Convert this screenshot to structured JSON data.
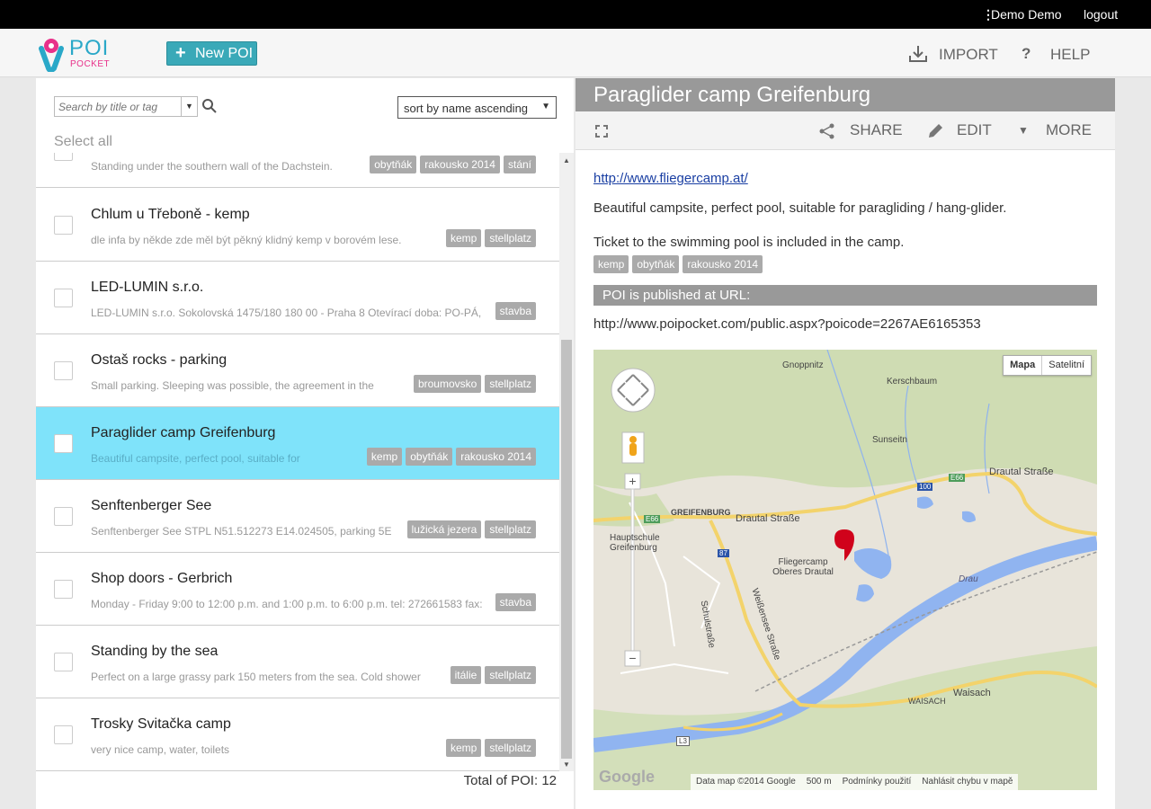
{
  "topbar": {
    "user": "Demo Demo",
    "logout": "logout"
  },
  "header": {
    "logo_poi": "POI",
    "logo_pocket": "POCKET",
    "new_poi": "New POI",
    "import": "IMPORT",
    "help": "HELP"
  },
  "list_controls": {
    "search_placeholder": "Search by title or tag",
    "sort_value": "sort by name ascending",
    "select_all": "Select all",
    "total": "Total of POI: 12"
  },
  "rows": [
    {
      "title": "",
      "desc": "Standing under the southern wall of the Dachstein.",
      "tags": [
        "obytňák",
        "rakousko 2014",
        "stání"
      ]
    },
    {
      "title": "Chlum u Třeboně - kemp",
      "desc": "dle infa by někde zde měl být pěkný klidný kemp v borovém lese.",
      "tags": [
        "kemp",
        "stellplatz"
      ]
    },
    {
      "title": "LED-LUMIN s.r.o.",
      "desc": "LED-LUMIN s.r.o. Sokolovská 1475/180 180 00 - Praha 8 Otevírací doba: PO-PÁ,",
      "tags": [
        "stavba"
      ]
    },
    {
      "title": "Ostaš rocks - parking",
      "desc": "Small parking.  Sleeping was possible, the agreement in the",
      "tags": [
        "broumovsko",
        "stellplatz"
      ]
    },
    {
      "title": "Paraglider camp Greifenburg",
      "desc": "Beautiful campsite, perfect pool, suitable for",
      "tags": [
        "kemp",
        "obytňák",
        "rakousko 2014"
      ]
    },
    {
      "title": "Senftenberger See",
      "desc": "Senftenberger See STPL N51.512273 E14.024505, parking 5E",
      "tags": [
        "lužická jezera",
        "stellplatz"
      ]
    },
    {
      "title": "Shop doors - Gerbrich",
      "desc": "Monday - Friday  9:00 to 12:00 p.m. and 1:00 p.m. to 6:00 p.m.  tel: 272661583 fax:",
      "tags": [
        "stavba"
      ]
    },
    {
      "title": "Standing by the sea",
      "desc": "Perfect on a large grassy park 150 meters from the sea. Cold shower",
      "tags": [
        "itálie",
        "stellplatz"
      ]
    },
    {
      "title": "Trosky Svitačka camp",
      "desc": "very nice camp, water, toilets",
      "tags": [
        "kemp",
        "stellplatz"
      ]
    }
  ],
  "detail": {
    "title": "Paraglider camp Greifenburg",
    "share": "SHARE",
    "edit": "EDIT",
    "more": "MORE",
    "link": "http://www.fliegercamp.at/",
    "p1": "Beautiful campsite, perfect pool, suitable for paragliding / hang-glider.",
    "p2": "Ticket to the swimming pool is included in the camp.",
    "tags": [
      "kemp",
      "obytňák",
      "rakousko 2014"
    ],
    "published_label": "POI is published at URL:",
    "published_url": "http://www.poipocket.com/public.aspx?poicode=2267AE6165353"
  },
  "map": {
    "type_map": "Mapa",
    "type_sat": "Satelitní",
    "google": "Google",
    "data": "Data map ©2014 Google",
    "scale": "500 m",
    "terms": "Podmínky použití",
    "report": "Nahlásit chybu v mapě",
    "labels": {
      "gnoppnitz": "Gnoppnitz",
      "kerschbaum": "Kerschbaum",
      "sunseitn": "Sunseitn",
      "drautal1": "Drautal Straße",
      "drautal2": "Drautal Straße",
      "greifenburg": "GREIFENBURG",
      "hauptschule": "Hauptschule Greifenburg",
      "fliegercamp": "Fliegercamp Oberes Drautal",
      "drau": "Drau",
      "weissensee": "Weißensee Straße",
      "schulstrasse": "Schulstraße",
      "waisach": "WAISACH",
      "waisach2": "Waisach",
      "e66a": "E66",
      "e66b": "E66",
      "r100": "100",
      "r87": "87",
      "l3": "L3"
    }
  },
  "colors": {
    "accent": "#3aa9b8",
    "selected_row": "#7fe3fa",
    "tag_bg": "#aaaaaa",
    "pink": "#e8318a"
  }
}
